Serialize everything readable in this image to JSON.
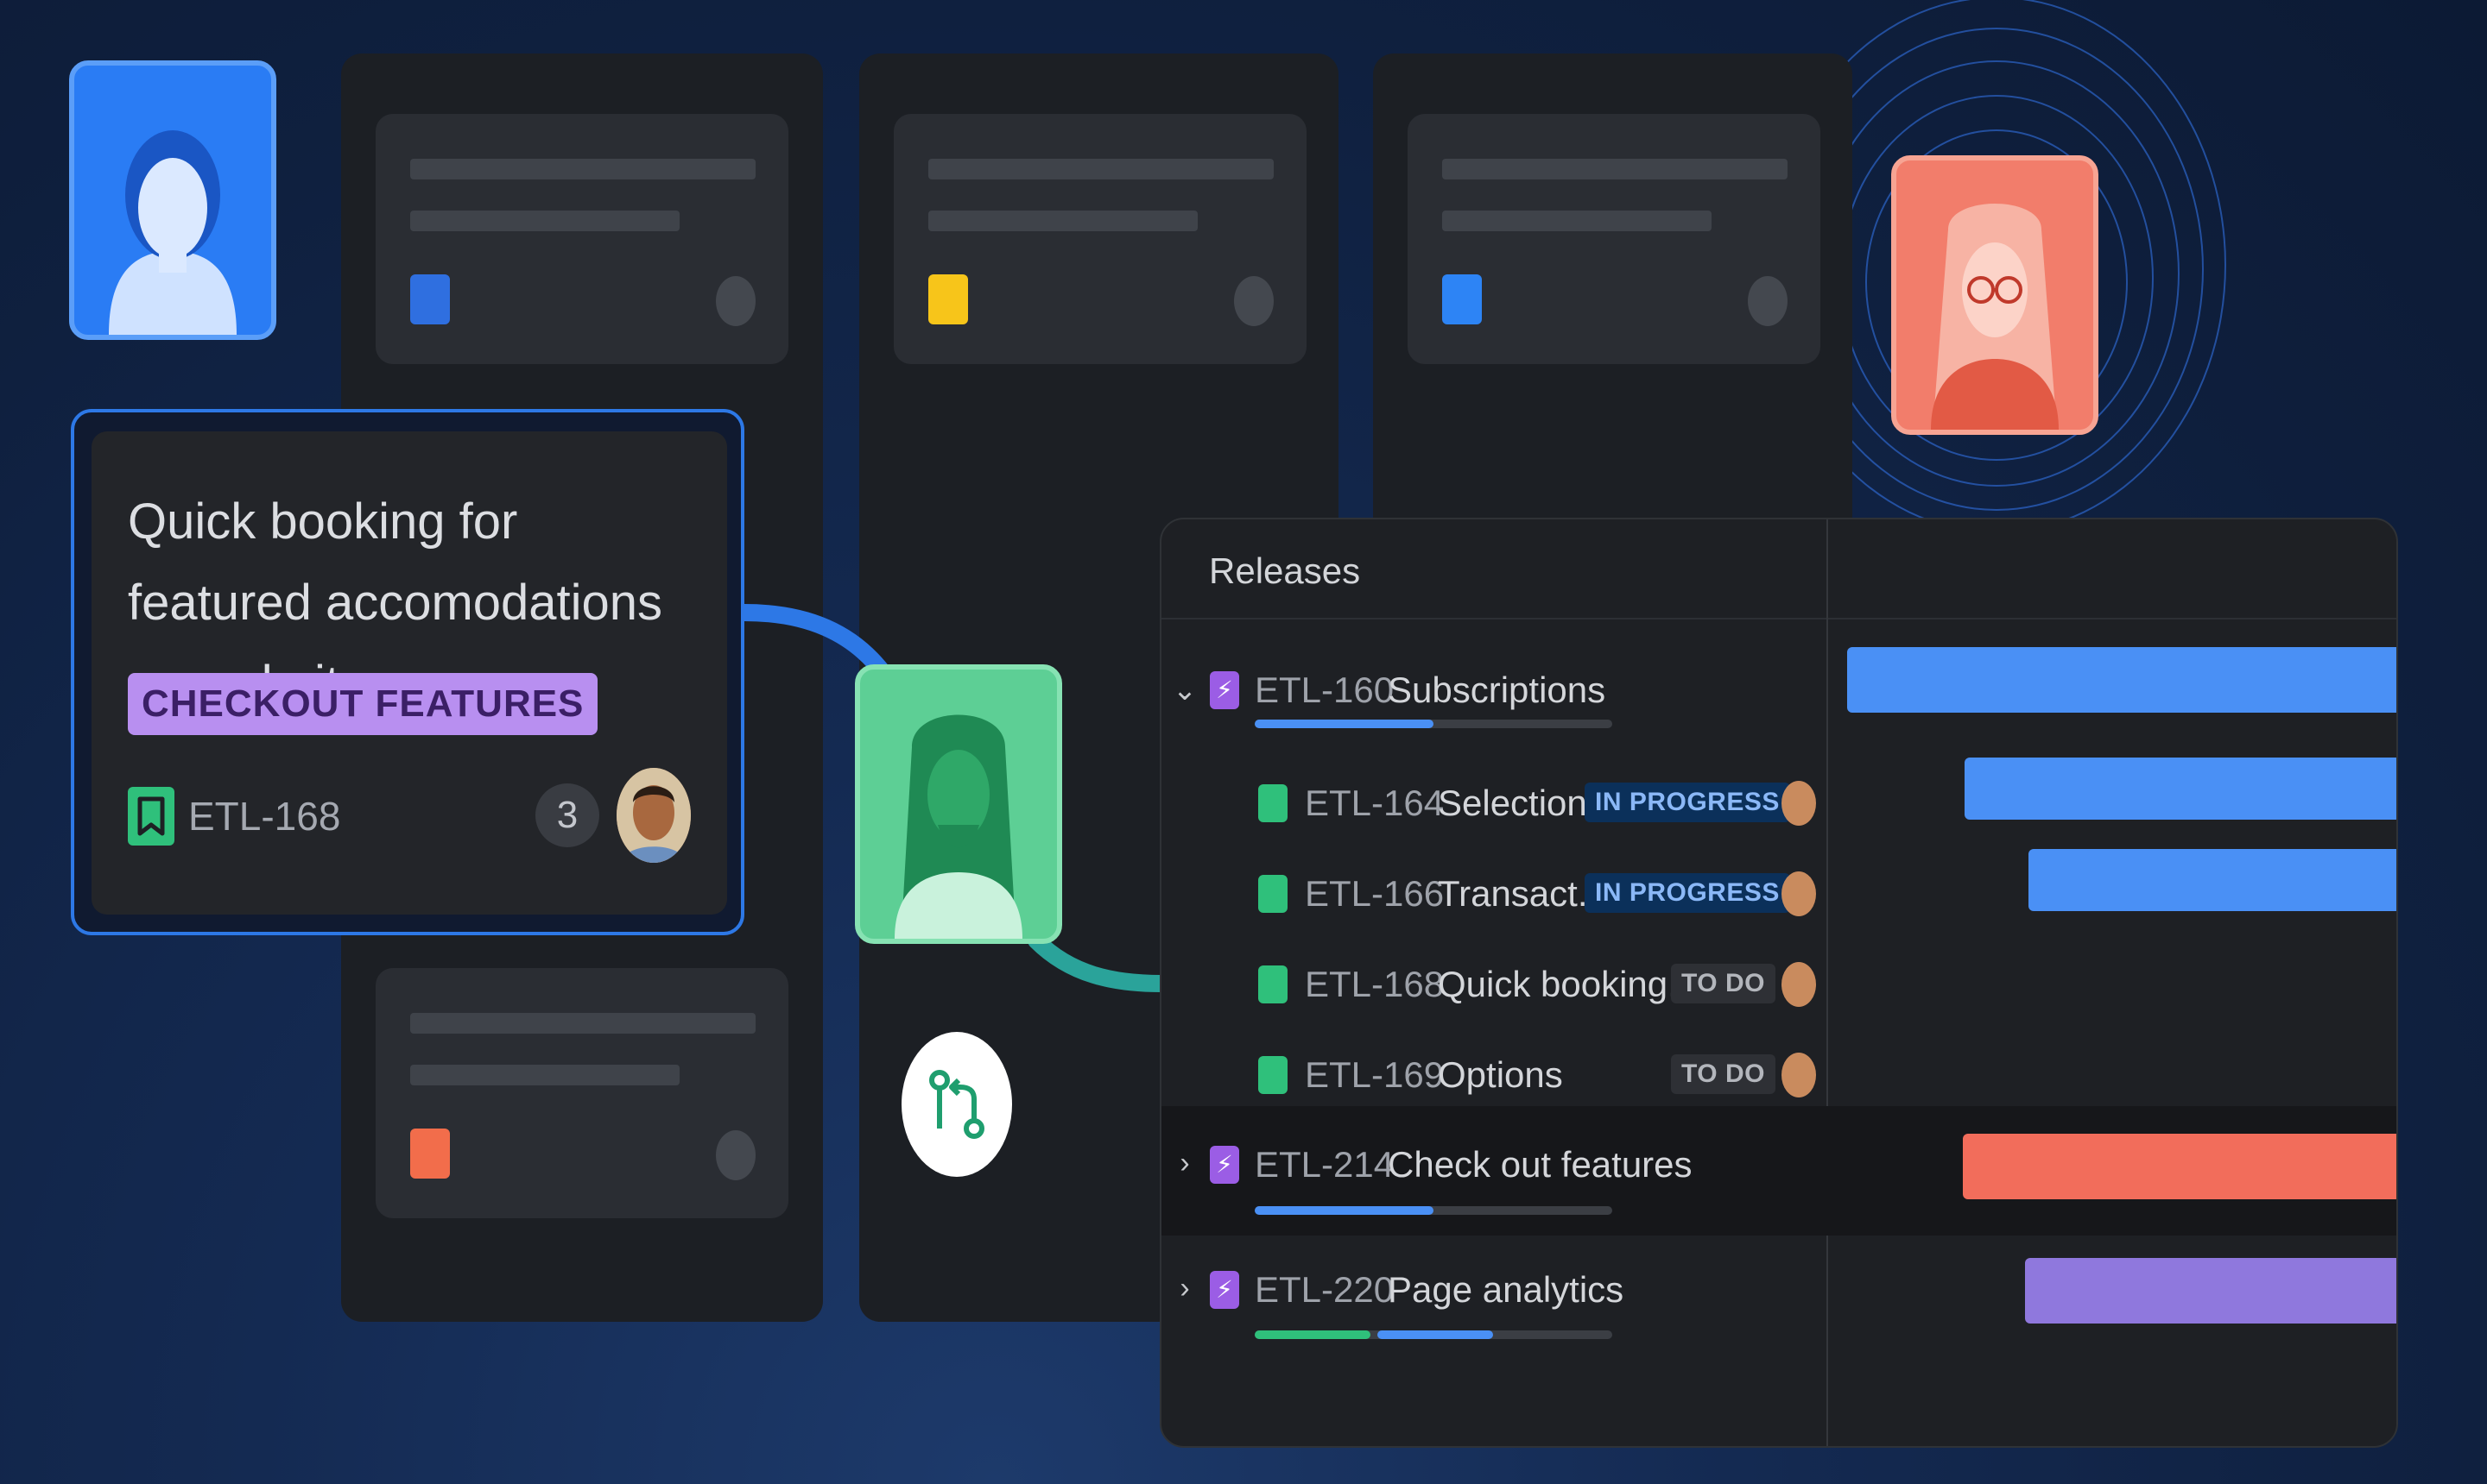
{
  "colors": {
    "background": "#0f203f",
    "accent_blue": "#4a90f5",
    "coral": "#f26d5b",
    "purple": "#8f78dd",
    "green": "#2fc07b",
    "label_purple": "#b88ff0",
    "in_progress_bg": "#0b305a",
    "in_progress_text": "#8bb8f7"
  },
  "board": {
    "columns": [
      {
        "cards": [
          {
            "accent": "#2f6fe0"
          },
          {
            "accent": "#f26d4b"
          }
        ]
      },
      {
        "cards": [
          {
            "accent": "#f7c51a"
          }
        ]
      },
      {
        "cards": [
          {
            "accent": "#2d84f5"
          }
        ]
      }
    ]
  },
  "featured_card": {
    "title": "Quick booking for featured accomodations on website",
    "label": "CHECKOUT FEATURES",
    "key": "ETL-168",
    "count": "3",
    "icon": "bookmark-icon"
  },
  "git_icon": "git-pull-request-icon",
  "releases": {
    "title": "Releases",
    "items": [
      {
        "key": "ETL-160",
        "name": "Subscriptions",
        "type": "epic",
        "expanded": true,
        "progress_done": 0.5
      },
      {
        "key": "ETL-164",
        "name": "Selection",
        "type": "story",
        "status": "IN PROGRESS"
      },
      {
        "key": "ETL-166",
        "name": "Transact...",
        "type": "story",
        "status": "IN PROGRESS"
      },
      {
        "key": "ETL-168",
        "name": "Quick booking...",
        "type": "story",
        "status": "TO DO"
      },
      {
        "key": "ETL-169",
        "name": "Options",
        "type": "story",
        "status": "TO DO"
      },
      {
        "key": "ETL-214",
        "name": "Check out features",
        "type": "epic",
        "expanded": false,
        "progress_done": 0.5
      },
      {
        "key": "ETL-220",
        "name": "Page analytics",
        "type": "epic",
        "expanded": false,
        "progress_done": 0.33,
        "progress_in_progress": 0.33
      }
    ],
    "timeline_bars": [
      {
        "key": "ETL-160",
        "color": "#4a90f5"
      },
      {
        "key": "ETL-164",
        "color": "#4a90f5"
      },
      {
        "key": "ETL-166",
        "color": "#4a90f5"
      },
      {
        "key": "ETL-214",
        "color": "#f26d5b"
      },
      {
        "key": "ETL-220",
        "color": "#8f78dd"
      }
    ]
  }
}
